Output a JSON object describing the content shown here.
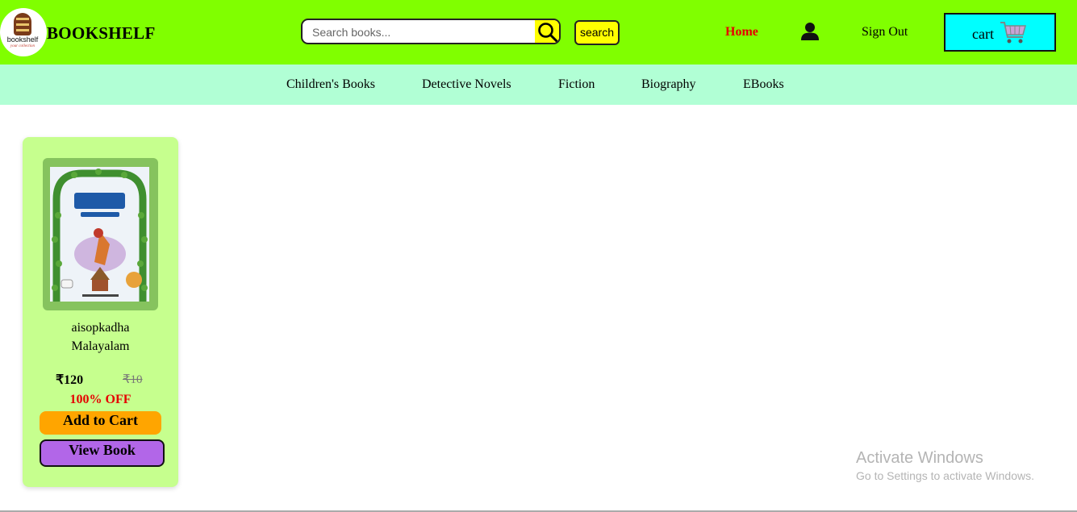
{
  "header": {
    "logo_text": "bookshelf",
    "logo_tagline": "your collection",
    "brand": "BOOKSHELF",
    "search_placeholder": "Search books...",
    "search_button": "search",
    "nav_home": "Home",
    "nav_signout": "Sign Out",
    "cart_label": "cart"
  },
  "categories": [
    "Children's Books",
    "Detective Novels",
    "Fiction",
    "Biography",
    "EBooks"
  ],
  "product": {
    "title_line1": "aisopkadha",
    "title_line2": "Malayalam",
    "price": "₹120",
    "mrp": "₹10",
    "discount": "100% OFF",
    "add_to_cart": "Add to Cart",
    "view_book": "View Book"
  },
  "watermark": {
    "title": "Activate Windows",
    "subtitle": "Go to Settings to activate Windows."
  },
  "colors": {
    "header_bg": "#80ff00",
    "category_bar_bg": "#b1ffd5",
    "card_bg": "#c6ff8e",
    "cart_bg": "#00ffff",
    "add_to_cart_bg": "#ffa500",
    "view_book_bg": "#b266e8",
    "home_link": "#e60000"
  },
  "icons": {
    "search": "magnifier-icon",
    "user": "user-icon",
    "cart": "shopping-cart-icon"
  }
}
